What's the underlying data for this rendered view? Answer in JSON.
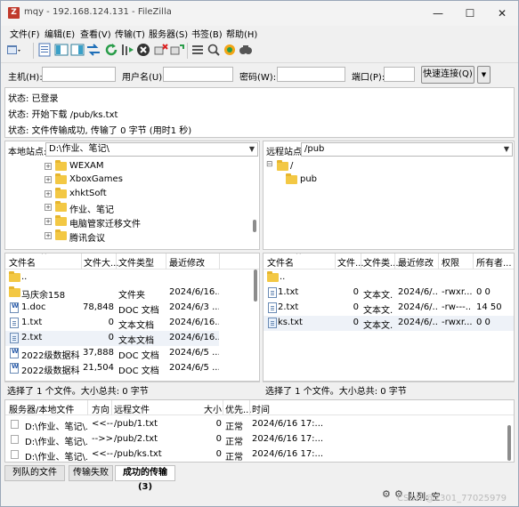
{
  "window": {
    "title": "mqy - 192.168.124.131 - FileZilla",
    "min": "—",
    "max": "☐",
    "close": "✕"
  },
  "menu": [
    "文件(F)",
    "编辑(E)",
    "查看(V)",
    "传输(T)",
    "服务器(S)",
    "书签(B)",
    "帮助(H)"
  ],
  "toolbar": {
    "icons": [
      "site-manager-icon",
      "toggle-log-icon",
      "toggle-local-tree-icon",
      "toggle-remote-tree-icon",
      "toggle-queue-icon",
      "refresh-icon",
      "process-queue-icon",
      "cancel-icon",
      "disconnect-icon",
      "reconnect-icon",
      "filter-icon",
      "compare-icon",
      "sync-browse-icon",
      "search-icon"
    ]
  },
  "quickconnect": {
    "host_label": "主机(H):",
    "user_label": "用户名(U):",
    "pass_label": "密码(W):",
    "port_label": "端口(P):",
    "host_value": "",
    "user_value": "",
    "pass_value": "",
    "port_value": "",
    "connect_button": "快速连接(Q)",
    "dropdown": "▼"
  },
  "log": [
    "状态: 已登录",
    "状态: 开始下载 /pub/ks.txt",
    "状态: 文件传输成功, 传输了 0 字节 (用时1 秒)"
  ],
  "local": {
    "site_label": "本地站点:",
    "site_path": "D:\\作业、笔记\\",
    "tree": [
      {
        "label": "WEXAM"
      },
      {
        "label": "XboxGames"
      },
      {
        "label": "xhktSoft"
      },
      {
        "label": "作业、笔记"
      },
      {
        "label": "电脑管家迁移文件"
      },
      {
        "label": "腾讯会议"
      }
    ],
    "columns": [
      "文件名",
      "文件大...",
      "文件类型",
      "最近修改"
    ],
    "files": [
      {
        "name": "..",
        "size": "",
        "type": "",
        "modified": "",
        "icon": "parent"
      },
      {
        "name": "马庆余158",
        "size": "",
        "type": "文件夹",
        "modified": "2024/6/16...",
        "icon": "folder"
      },
      {
        "name": "1.doc",
        "size": "78,848",
        "type": "DOC 文档",
        "modified": "2024/6/3 ...",
        "icon": "doc"
      },
      {
        "name": "1.txt",
        "size": "0",
        "type": "文本文档",
        "modified": "2024/6/16...",
        "icon": "txt"
      },
      {
        "name": "2.txt",
        "size": "0",
        "type": "文本文档",
        "modified": "2024/6/16...",
        "icon": "txt"
      },
      {
        "name": "2022级数据科...",
        "size": "37,888",
        "type": "DOC 文档",
        "modified": "2024/6/5 ...",
        "icon": "doc"
      },
      {
        "name": "2022级数据科...",
        "size": "21,504",
        "type": "DOC 文档",
        "modified": "2024/6/5 ...",
        "icon": "doc"
      }
    ],
    "status": "选择了 1 个文件。大小总共: 0 字节"
  },
  "remote": {
    "site_label": "远程站点:",
    "site_path": "/pub",
    "tree": [
      {
        "label": "/"
      },
      {
        "label": "pub"
      }
    ],
    "columns": [
      "文件名",
      "文件...",
      "文件类...",
      "最近修改",
      "权限",
      "所有者..."
    ],
    "files": [
      {
        "name": "..",
        "size": "",
        "type": "",
        "modified": "",
        "perms": "",
        "owner": "",
        "icon": "parent"
      },
      {
        "name": "1.txt",
        "size": "0",
        "type": "文本文...",
        "modified": "2024/6/...",
        "perms": "-rwxr...",
        "owner": "0 0",
        "icon": "txt"
      },
      {
        "name": "2.txt",
        "size": "0",
        "type": "文本文...",
        "modified": "2024/6/...",
        "perms": "-rw---...",
        "owner": "14 50",
        "icon": "txt"
      },
      {
        "name": "ks.txt",
        "size": "0",
        "type": "文本文...",
        "modified": "2024/6/...",
        "perms": "-rwxr...",
        "owner": "0 0",
        "icon": "txt"
      }
    ],
    "status": "选择了 1 个文件。大小总共: 0 字节"
  },
  "queue": {
    "columns": [
      "服务器/本地文件",
      "方向",
      "远程文件",
      "大小",
      "优先...",
      "时间"
    ],
    "rows": [
      {
        "local": "D:\\作业、笔记\\...",
        "dir": "<<--",
        "remote": "/pub/1.txt",
        "size": "0",
        "priority": "正常",
        "time": "2024/6/16 17:..."
      },
      {
        "local": "D:\\作业、笔记\\...",
        "dir": "-->>",
        "remote": "/pub/2.txt",
        "size": "0",
        "priority": "正常",
        "time": "2024/6/16 17:..."
      },
      {
        "local": "D:\\作业、笔记\\...",
        "dir": "<<--",
        "remote": "/pub/ks.txt",
        "size": "0",
        "priority": "正常",
        "time": "2024/6/16 17:..."
      }
    ]
  },
  "tabs": [
    "列队的文件",
    "传输失败",
    "成功的传输 (3)"
  ],
  "statusbar": {
    "queue_label": "队列: 空",
    "watermark": "CSDN @2301_77025979"
  }
}
